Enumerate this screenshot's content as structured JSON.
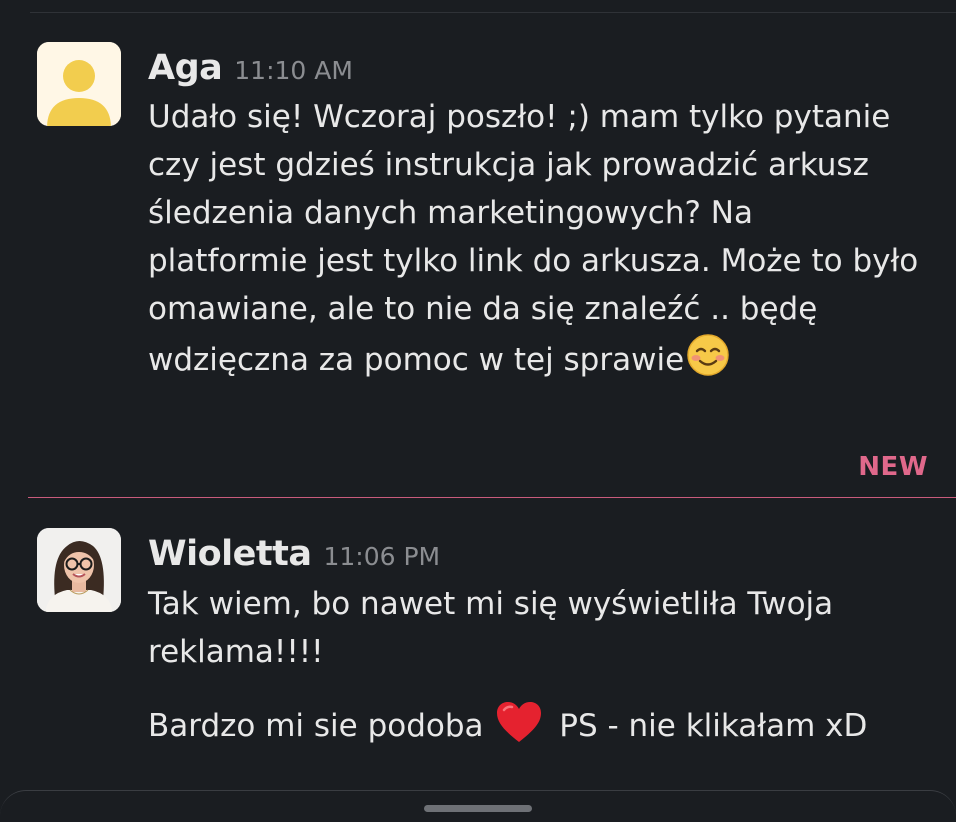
{
  "messages": [
    {
      "author": "Aga",
      "time": "11:10 AM",
      "avatar_icon": "user-silhouette-icon",
      "text": "Udało się! Wczoraj poszło! ;) mam tylko pytanie czy jest gdzieś instrukcja jak prowadzić arkusz śledzenia danych marketingowych? Na platformie jest tylko link do arkusza. Może to było omawiane, ale to nie da się znaleźć .. będę wdzięczna za pomoc w tej sprawie",
      "trailing_emoji": "smiling-face-icon"
    },
    {
      "author": "Wioletta",
      "time": "11:06 PM",
      "avatar_icon": "profile-photo",
      "paragraph1": "Tak wiem, bo nawet mi się wyświetliła Twoja reklama!!!!",
      "paragraph2_before": "Bardzo mi sie podoba ",
      "paragraph2_emoji": "red-heart-icon",
      "paragraph2_after": " PS - nie klikałam xD"
    }
  ],
  "new_divider": {
    "label": "NEW",
    "color": "#e0688b"
  },
  "colors": {
    "background": "#1a1d21",
    "text": "#e8e8e8",
    "timestamp": "#8b8d91",
    "avatar_yellow": "#f2cd4e"
  }
}
